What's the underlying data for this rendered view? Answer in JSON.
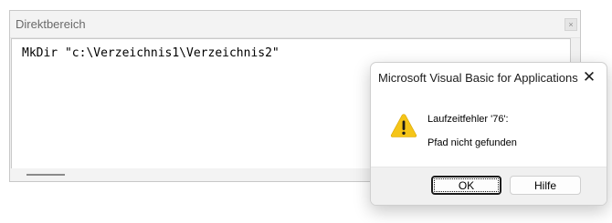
{
  "immediate_window": {
    "title": "Direktbereich",
    "close_glyph": "×",
    "code_line": "MkDir \"c:\\Verzeichnis1\\Verzeichnis2\""
  },
  "message_box": {
    "title": "Microsoft Visual Basic for Applications",
    "close_glyph": "✕",
    "icon": "warning-icon",
    "error_line": "Laufzeitfehler '76':",
    "message_line": "Pfad nicht gefunden",
    "buttons": {
      "ok_label": "OK",
      "help_label": "Hilfe"
    }
  },
  "colors": {
    "warning_fill": "#f5c518",
    "warning_mark": "#1b1b1b",
    "footer_bg": "#f0f0f0"
  }
}
